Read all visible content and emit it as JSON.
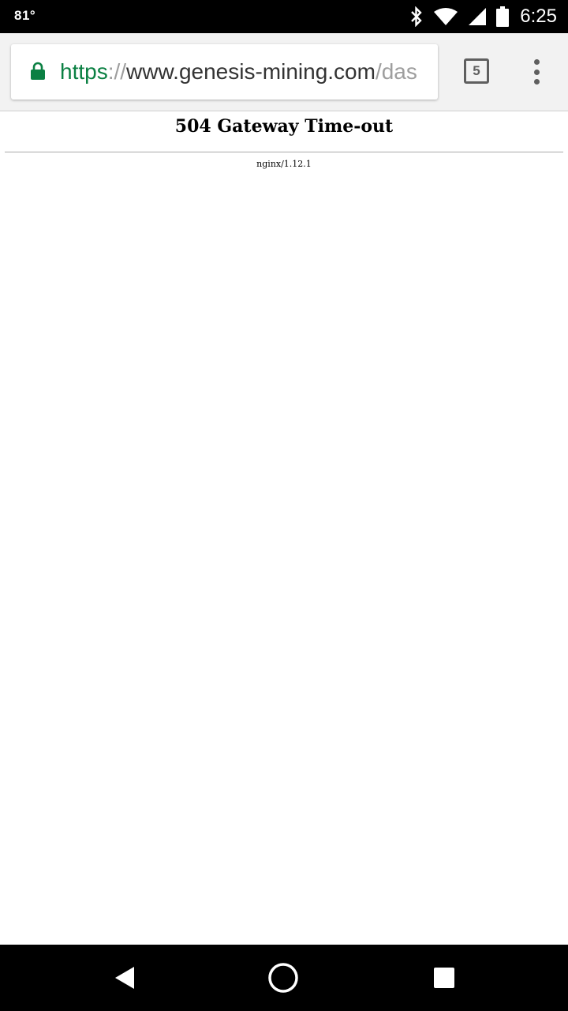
{
  "status_bar": {
    "temperature": "81°",
    "time": "6:25",
    "icons": [
      "bluetooth-icon",
      "wifi-icon",
      "cell-signal-icon",
      "battery-icon"
    ]
  },
  "browser": {
    "url_scheme": "https",
    "url_separator": "://",
    "url_host": "www.genesis-mining.com",
    "url_path": "/das",
    "tab_count": "5",
    "secure_color": "#0b8043"
  },
  "page": {
    "title": "504 Gateway Time-out",
    "server": "nginx/1.12.1"
  },
  "nav_bar": {
    "buttons": [
      "back-icon",
      "home-icon",
      "recents-icon"
    ]
  }
}
